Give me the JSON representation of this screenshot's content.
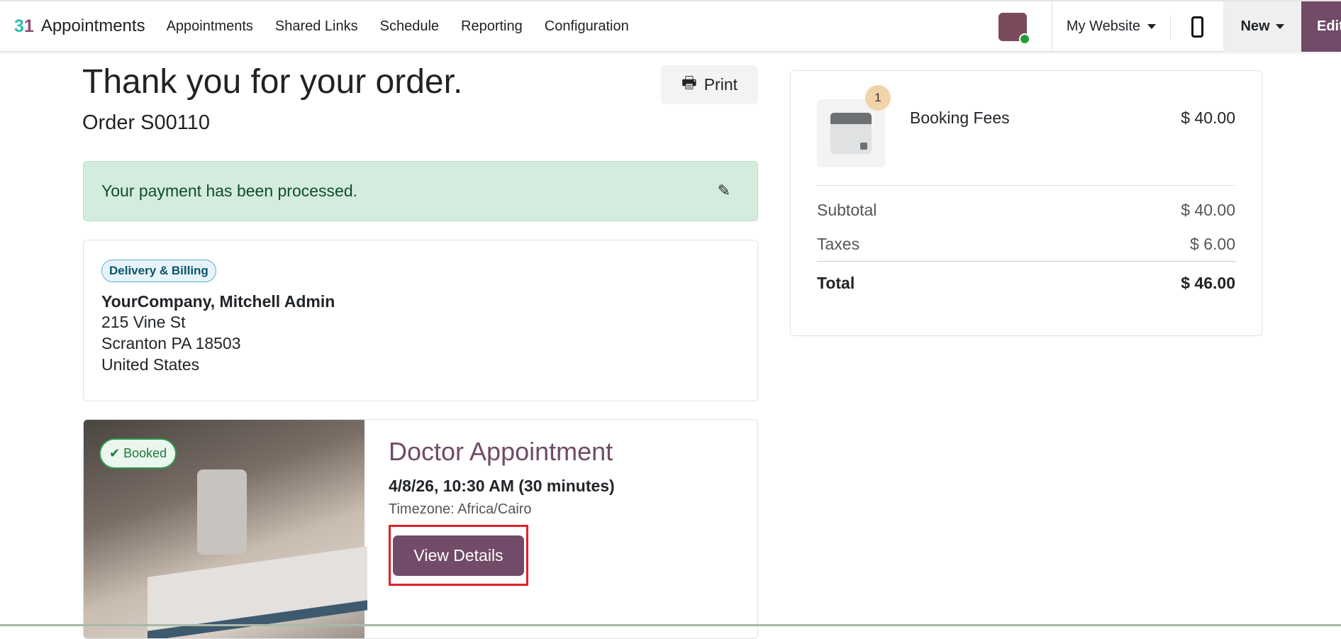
{
  "navbar": {
    "app_name": "Appointments",
    "menu": [
      "Appointments",
      "Shared Links",
      "Schedule",
      "Reporting",
      "Configuration"
    ],
    "website": "My Website",
    "new_label": "New",
    "edit_label": "Edit"
  },
  "page": {
    "title": "Thank you for your order.",
    "order": "Order S00110",
    "print_label": "Print",
    "payment_message": "Your payment has been processed."
  },
  "address": {
    "badge": "Delivery & Billing",
    "name": "YourCompany, Mitchell Admin",
    "lines": [
      "215 Vine St",
      "Scranton PA 18503",
      "United States"
    ]
  },
  "appointment": {
    "status": "Booked",
    "title": "Doctor Appointment",
    "datetime": "4/8/26, 10:30 AM (30 minutes)",
    "timezone": "Timezone: Africa/Cairo",
    "button": "View Details"
  },
  "summary": {
    "product": {
      "qty": "1",
      "name": "Booking Fees",
      "price": "$ 40.00"
    },
    "subtotal_label": "Subtotal",
    "subtotal": "$ 40.00",
    "taxes_label": "Taxes",
    "taxes": "$ 6.00",
    "total_label": "Total",
    "total": "$ 46.00"
  },
  "colors": {
    "brand": "#714b67",
    "success_bg": "#d4ecdd",
    "highlight": "#e0202a"
  }
}
